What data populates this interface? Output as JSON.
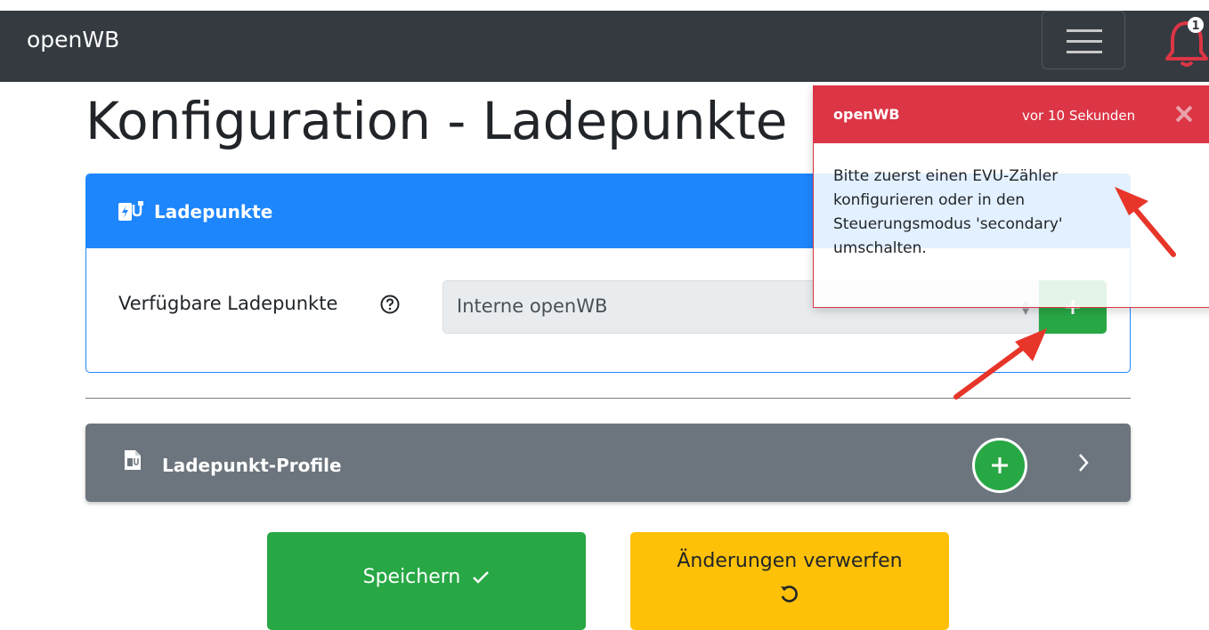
{
  "navbar": {
    "brand": "openWB",
    "notification_count": "1"
  },
  "page": {
    "title": "Konfiguration - Ladepunkte"
  },
  "ladepunkte_card": {
    "title": "Ladepunkte",
    "available_label": "Verfügbare Ladepunkte",
    "select_value": "Interne openWB",
    "add_label": "+"
  },
  "profiles_card": {
    "title": "Ladepunkt-Profile",
    "add_label": "+"
  },
  "actions": {
    "save_label": "Speichern",
    "discard_label": "Änderungen verwerfen"
  },
  "toast": {
    "title": "openWB",
    "time": "vor 10 Sekunden",
    "message": "Bitte zuerst einen EVU-Zähler konfigurieren oder in den Steuerungsmodus 'secondary' umschalten."
  },
  "colors": {
    "navbar": "#343a40",
    "primary": "#1e86fc",
    "secondary": "#6c757d",
    "success": "#28a745",
    "warning": "#ffc107",
    "danger": "#dc3545"
  },
  "icons": {
    "bell": "bell-icon",
    "menu": "hamburger-menu-icon",
    "ladepunkte": "charging-station-icon",
    "profiles": "charging-profile-icon",
    "help": "question-circle-icon",
    "expand": "chevron-right-icon",
    "save": "check-icon",
    "discard": "undo-icon",
    "close": "close-icon"
  }
}
